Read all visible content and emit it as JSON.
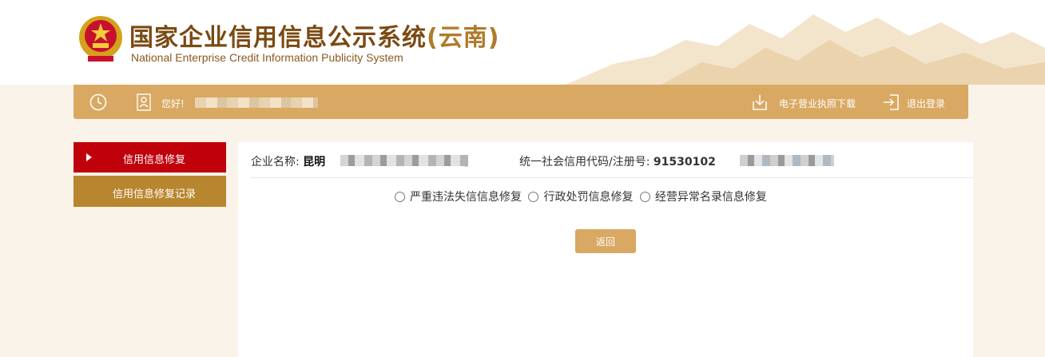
{
  "header": {
    "title_cn": "国家企业信用信息公示系统",
    "title_region": "(云南)",
    "title_en": "National Enterprise Credit Information Publicity System",
    "emblem_icon": "national-emblem-icon"
  },
  "topbar": {
    "greeting": "您好!",
    "download_label": "电子营业执照下载",
    "logout_label": "退出登录",
    "bg_color": "#d9a862"
  },
  "sidebar": {
    "items": [
      {
        "label": "信用信息修复",
        "active": true,
        "color": "#c0000b"
      },
      {
        "label": "信用信息修复记录",
        "active": false,
        "color": "#b8862e"
      }
    ]
  },
  "main": {
    "company_name_label": "企业名称:",
    "company_name_value": "昆明",
    "company_name_tail": "司",
    "credit_code_label": "统一社会信用代码/注册号:",
    "credit_code_value": "91530102",
    "options": [
      "严重违法失信信息修复",
      "行政处罚信息修复",
      "经营异常名录信息修复"
    ],
    "back_label": "返回"
  }
}
